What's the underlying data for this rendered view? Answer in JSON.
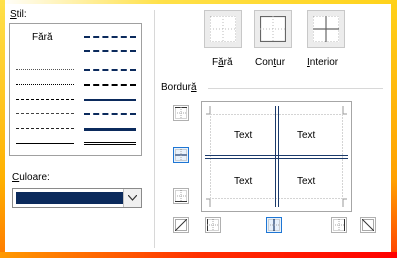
{
  "style": {
    "label_underlined": "S",
    "label_rest": "til:",
    "none_label": "Fără"
  },
  "color": {
    "label_underlined": "C",
    "label_rest": "uloare:",
    "value": "#0b2a5c"
  },
  "presets": {
    "none": {
      "pre": "F",
      "underlined": "ă",
      "post": "ră"
    },
    "outline": {
      "pre": "Con",
      "underlined": "t",
      "post": "ur"
    },
    "inside": {
      "pre": "",
      "underlined": "I",
      "post": "nterior"
    }
  },
  "border": {
    "label_pre": "Bordur",
    "label_underlined": "ă",
    "label_post": ""
  },
  "preview": {
    "cells": [
      "Text",
      "Text",
      "Text",
      "Text"
    ]
  },
  "colors": {
    "accent": "#1e76d4",
    "border_line": "#1b3a6b"
  }
}
